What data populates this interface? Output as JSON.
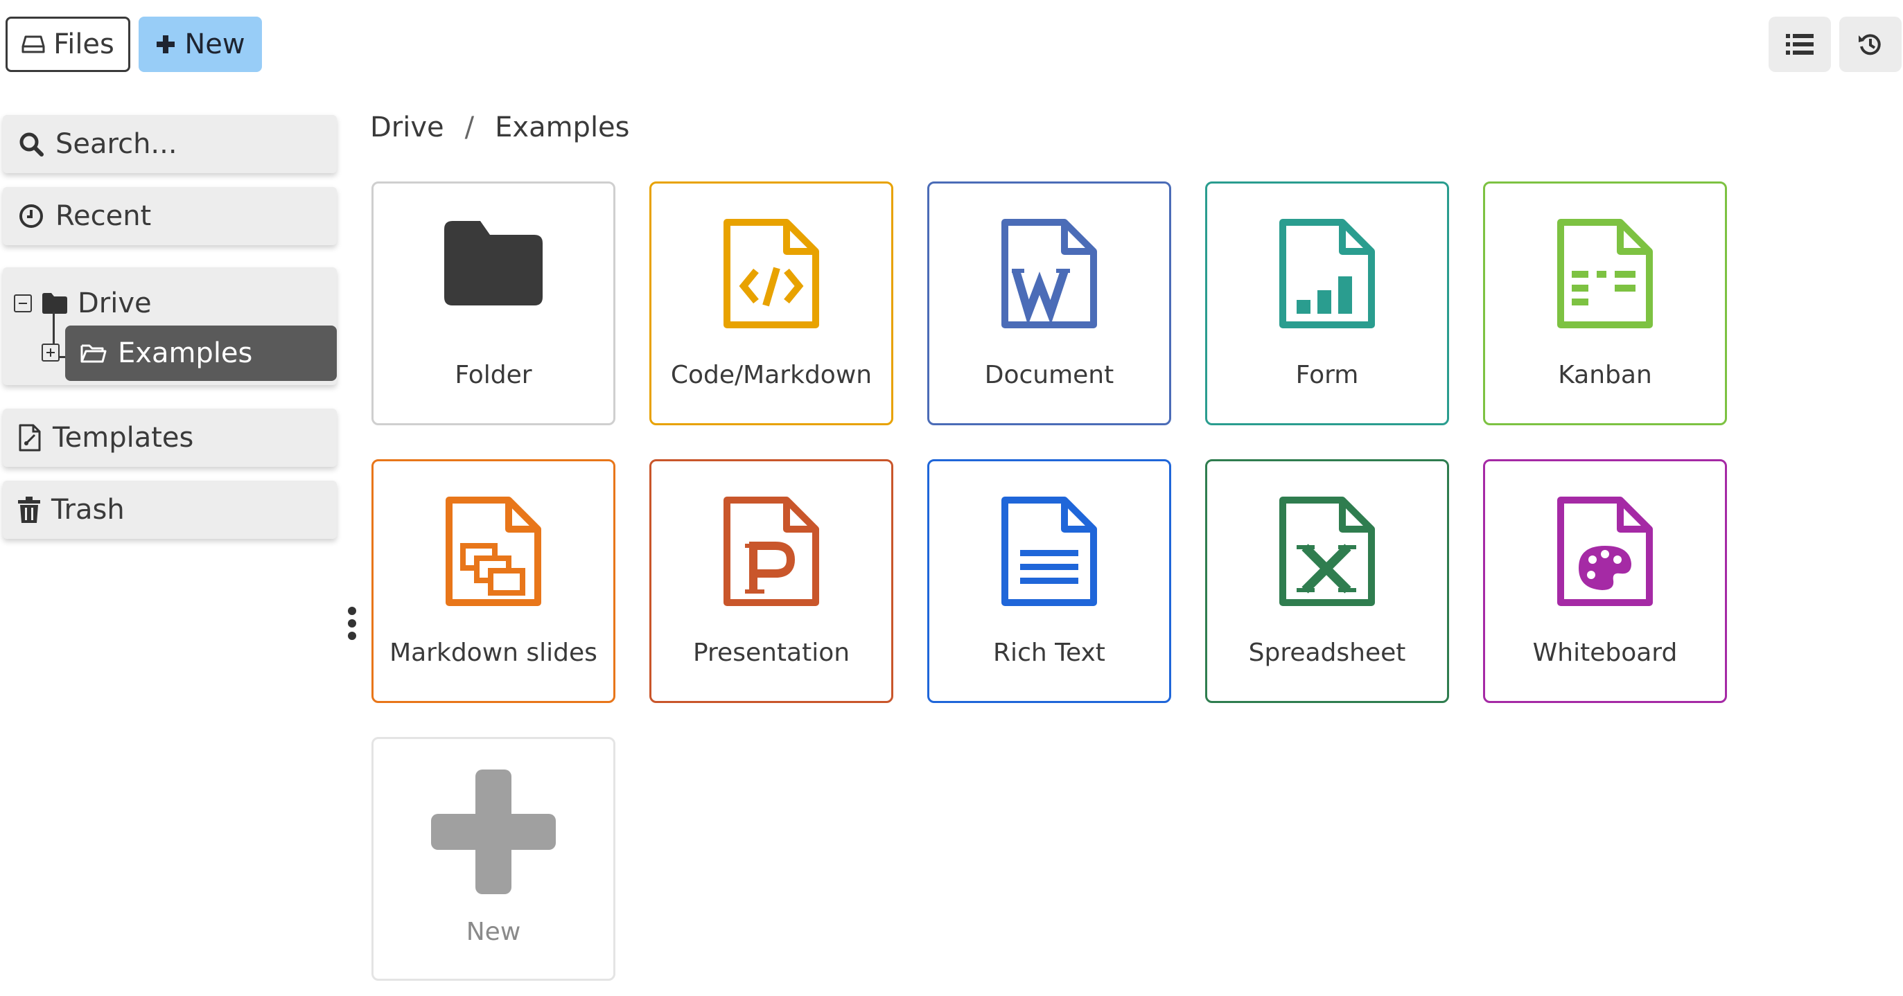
{
  "toolbar": {
    "files_label": "Files",
    "new_label": "New"
  },
  "sidebar": {
    "search_placeholder": "Search...",
    "recent_label": "Recent",
    "tree": {
      "root_label": "Drive",
      "child_label": "Examples"
    },
    "templates_label": "Templates",
    "trash_label": "Trash"
  },
  "breadcrumb": {
    "root": "Drive",
    "separator": "/",
    "current": "Examples"
  },
  "tiles": [
    {
      "label": "Folder",
      "color": "#3a3a3a",
      "icon": "folder-icon"
    },
    {
      "label": "Code/Markdown",
      "color": "#e8a200",
      "icon": "code-file-icon"
    },
    {
      "label": "Document",
      "color": "#4b6cb7",
      "icon": "word-document-icon"
    },
    {
      "label": "Form",
      "color": "#2a9d8f",
      "icon": "form-chart-icon"
    },
    {
      "label": "Kanban",
      "color": "#7dc242",
      "icon": "kanban-icon"
    },
    {
      "label": "Markdown slides",
      "color": "#e8761a",
      "icon": "slides-icon"
    },
    {
      "label": "Presentation",
      "color": "#c9562b",
      "icon": "presentation-icon"
    },
    {
      "label": "Rich Text",
      "color": "#1f66d9",
      "icon": "rich-text-icon"
    },
    {
      "label": "Spreadsheet",
      "color": "#2f7d4f",
      "icon": "spreadsheet-icon"
    },
    {
      "label": "Whiteboard",
      "color": "#a52aa5",
      "icon": "whiteboard-icon"
    },
    {
      "label": "New",
      "color": "#a0a0a0",
      "icon": "plus-icon"
    }
  ]
}
